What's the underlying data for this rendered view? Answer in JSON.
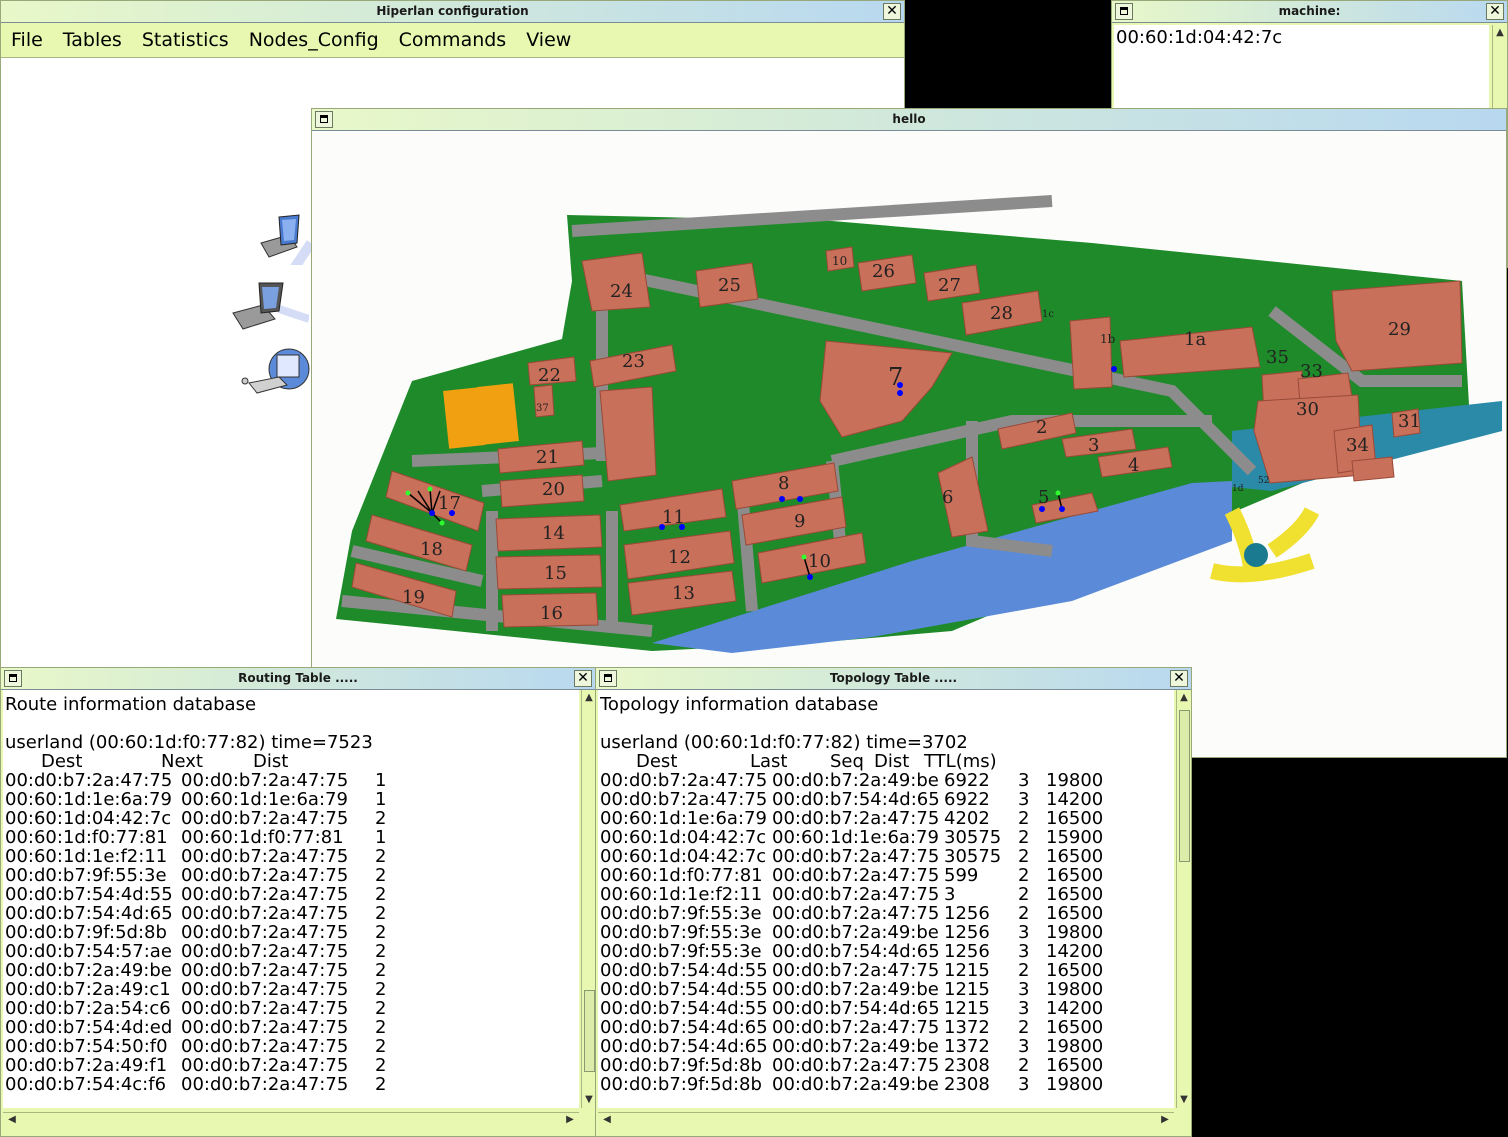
{
  "hiperlan": {
    "title": "Hiperlan configuration",
    "menu": [
      "File",
      "Tables",
      "Statistics",
      "Nodes_Config",
      "Commands",
      "View"
    ]
  },
  "machine": {
    "title": "machine:",
    "value": "00:60:1d:04:42:7c"
  },
  "hello": {
    "title": "hello",
    "map_labels": [
      "24",
      "25",
      "10",
      "26",
      "27",
      "28",
      "1c",
      "1b",
      "1a",
      "29",
      "35",
      "33",
      "30",
      "31",
      "34",
      "22",
      "23",
      "21",
      "20",
      "7",
      "2",
      "3",
      "4",
      "6",
      "5",
      "17",
      "18",
      "19",
      "14",
      "15",
      "16",
      "11",
      "12",
      "13",
      "8",
      "9",
      "10",
      "1d",
      "52",
      "37"
    ]
  },
  "routing": {
    "title": "Routing Table .....",
    "heading": "Route information database",
    "subheading": "userland (00:60:1d:f0:77:82) time=7523",
    "columns": [
      "Dest",
      "Next",
      "Dist"
    ],
    "rows": [
      [
        "00:d0:b7:2a:47:75",
        "00:d0:b7:2a:47:75",
        "1"
      ],
      [
        "00:60:1d:1e:6a:79",
        "00:60:1d:1e:6a:79",
        "1"
      ],
      [
        "00:60:1d:04:42:7c",
        "00:d0:b7:2a:47:75",
        "2"
      ],
      [
        "00:60:1d:f0:77:81",
        "00:60:1d:f0:77:81",
        "1"
      ],
      [
        "00:60:1d:1e:f2:11",
        "00:d0:b7:2a:47:75",
        "2"
      ],
      [
        "00:d0:b7:9f:55:3e",
        "00:d0:b7:2a:47:75",
        "2"
      ],
      [
        "00:d0:b7:54:4d:55",
        "00:d0:b7:2a:47:75",
        "2"
      ],
      [
        "00:d0:b7:54:4d:65",
        "00:d0:b7:2a:47:75",
        "2"
      ],
      [
        "00:d0:b7:9f:5d:8b",
        "00:d0:b7:2a:47:75",
        "2"
      ],
      [
        "00:d0:b7:54:57:ae",
        "00:d0:b7:2a:47:75",
        "2"
      ],
      [
        "00:d0:b7:2a:49:be",
        "00:d0:b7:2a:47:75",
        "2"
      ],
      [
        "00:d0:b7:2a:49:c1",
        "00:d0:b7:2a:47:75",
        "2"
      ],
      [
        "00:d0:b7:2a:54:c6",
        "00:d0:b7:2a:47:75",
        "2"
      ],
      [
        "00:d0:b7:54:4d:ed",
        "00:d0:b7:2a:47:75",
        "2"
      ],
      [
        "00:d0:b7:54:50:f0",
        "00:d0:b7:2a:47:75",
        "2"
      ],
      [
        "00:d0:b7:2a:49:f1",
        "00:d0:b7:2a:47:75",
        "2"
      ],
      [
        "00:d0:b7:54:4c:f6",
        "00:d0:b7:2a:47:75",
        "2"
      ]
    ]
  },
  "topology": {
    "title": "Topology Table .....",
    "heading": "Topology information database",
    "subheading": "userland (00:60:1d:f0:77:82) time=3702",
    "columns": [
      "Dest",
      "Last",
      "Seq",
      "Dist",
      "TTL(ms)"
    ],
    "rows": [
      [
        "00:d0:b7:2a:47:75",
        "00:d0:b7:2a:49:be",
        "6922",
        "3",
        "19800"
      ],
      [
        "00:d0:b7:2a:47:75",
        "00:d0:b7:54:4d:65",
        "6922",
        "3",
        "14200"
      ],
      [
        "00:60:1d:1e:6a:79",
        "00:d0:b7:2a:47:75",
        "4202",
        "2",
        "16500"
      ],
      [
        "00:60:1d:04:42:7c",
        "00:60:1d:1e:6a:79",
        "30575",
        "2",
        "15900"
      ],
      [
        "00:60:1d:04:42:7c",
        "00:d0:b7:2a:47:75",
        "30575",
        "2",
        "16500"
      ],
      [
        "00:60:1d:f0:77:81",
        "00:d0:b7:2a:47:75",
        "599",
        "2",
        "16500"
      ],
      [
        "00:60:1d:1e:f2:11",
        "00:d0:b7:2a:47:75",
        "3",
        "2",
        "16500"
      ],
      [
        "00:d0:b7:9f:55:3e",
        "00:d0:b7:2a:47:75",
        "1256",
        "2",
        "16500"
      ],
      [
        "00:d0:b7:9f:55:3e",
        "00:d0:b7:2a:49:be",
        "1256",
        "3",
        "19800"
      ],
      [
        "00:d0:b7:9f:55:3e",
        "00:d0:b7:54:4d:65",
        "1256",
        "3",
        "14200"
      ],
      [
        "00:d0:b7:54:4d:55",
        "00:d0:b7:2a:47:75",
        "1215",
        "2",
        "16500"
      ],
      [
        "00:d0:b7:54:4d:55",
        "00:d0:b7:2a:49:be",
        "1215",
        "3",
        "19800"
      ],
      [
        "00:d0:b7:54:4d:55",
        "00:d0:b7:54:4d:65",
        "1215",
        "3",
        "14200"
      ],
      [
        "00:d0:b7:54:4d:65",
        "00:d0:b7:2a:47:75",
        "1372",
        "2",
        "16500"
      ],
      [
        "00:d0:b7:54:4d:65",
        "00:d0:b7:2a:49:be",
        "1372",
        "3",
        "19800"
      ],
      [
        "00:d0:b7:9f:5d:8b",
        "00:d0:b7:2a:47:75",
        "2308",
        "2",
        "16500"
      ],
      [
        "00:d0:b7:9f:5d:8b",
        "00:d0:b7:2a:49:be",
        "2308",
        "3",
        "19800"
      ]
    ]
  },
  "colors": {
    "menubar": "#e8f8b0",
    "grass": "#1e8a2a",
    "building": "#c8705a",
    "road": "#8c8c8c",
    "water": "#5a8ad8",
    "court": "#f0a010",
    "node": "#0000ff"
  }
}
